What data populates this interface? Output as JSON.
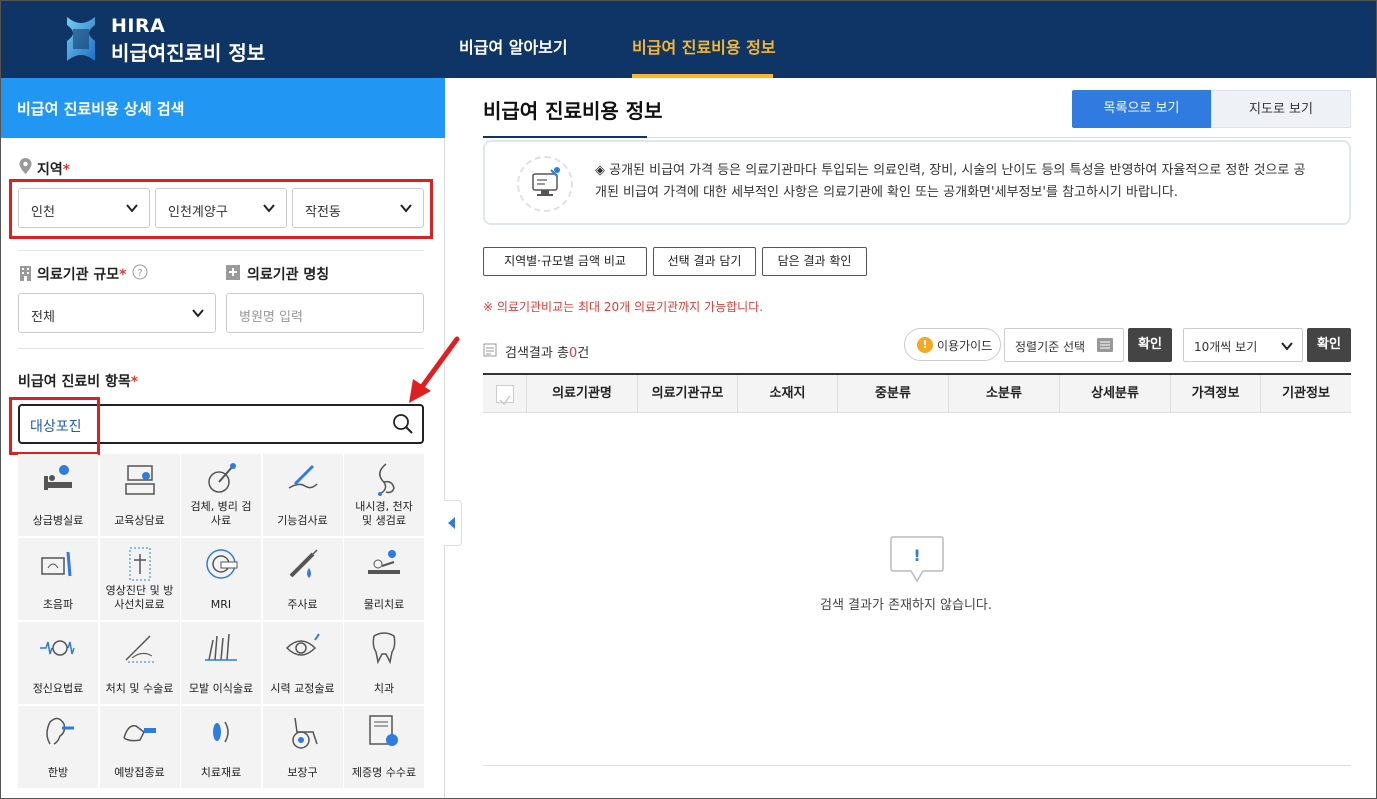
{
  "header": {
    "logo_line1": "HIRA",
    "logo_line2": "비급여진료비 정보",
    "nav": [
      {
        "label": "비급여 알아보기",
        "active": false
      },
      {
        "label": "비급여 진료비용 정보",
        "active": true
      }
    ]
  },
  "left": {
    "heading": "비급여 진료비용 상세 검색",
    "region_label": "지역",
    "region_selects": [
      "인천",
      "인천계양구",
      "작전동"
    ],
    "scale_label": "의료기관 규모",
    "scale_value": "전체",
    "name_label": "의료기관 명칭",
    "name_placeholder": "병원명 입력",
    "item_label": "비급여 진료비 항목",
    "search_value": "대상포진",
    "required_mark": "*",
    "categories": [
      {
        "label": "상급병실료",
        "icon": "hospital-bed-icon"
      },
      {
        "label": "교육상담료",
        "icon": "counseling-desk-icon"
      },
      {
        "label": "검체, 병리 검사료",
        "icon": "specimen-test-icon"
      },
      {
        "label": "기능검사료",
        "icon": "function-test-icon"
      },
      {
        "label": "내시경, 천자 및 생검료",
        "icon": "endoscope-icon"
      },
      {
        "label": "초음파",
        "icon": "ultrasound-icon"
      },
      {
        "label": "영상진단 및 방사선치료료",
        "icon": "radiology-icon"
      },
      {
        "label": "MRI",
        "icon": "mri-icon"
      },
      {
        "label": "주사료",
        "icon": "syringe-icon"
      },
      {
        "label": "물리치료",
        "icon": "physical-therapy-icon"
      },
      {
        "label": "정신요법료",
        "icon": "brain-wave-icon"
      },
      {
        "label": "처치 및 수술료",
        "icon": "surgery-icon"
      },
      {
        "label": "모발 이식술료",
        "icon": "hair-transplant-icon"
      },
      {
        "label": "시력 교정술료",
        "icon": "eye-icon"
      },
      {
        "label": "치과",
        "icon": "tooth-icon"
      },
      {
        "label": "한방",
        "icon": "acupuncture-ear-icon"
      },
      {
        "label": "예방접종료",
        "icon": "vaccination-icon"
      },
      {
        "label": "치료재료",
        "icon": "treatment-material-icon"
      },
      {
        "label": "보장구",
        "icon": "wheelchair-icon"
      },
      {
        "label": "제증명 수수료",
        "icon": "certificate-icon"
      }
    ]
  },
  "main": {
    "title": "비급여 진료비용 정보",
    "view_list": "목록으로 보기",
    "view_map": "지도로 보기",
    "notice": "◈ 공개된 비급여 가격 등은 의료기관마다 투입되는 의료인력, 장비, 시술의 난이도 등의 특성을 반영하여 자율적으로 정한 것으로 공개된 비급여 가격에 대한 세부적인 사항은 의료기관에 확인 또는 공개화면'세부정보'를 참고하시기 바랍니다.",
    "actions": [
      "지역별·규모별 금액 비교",
      "선택 결과 담기",
      "담은 결과 확인"
    ],
    "warning": "※ 의료기관비교는 최대 20개 의료기관까지 가능합니다.",
    "result_prefix": "검색결과 총",
    "result_count": "0",
    "result_suffix": "건",
    "guide": "이용가이드",
    "sort_placeholder": "정렬기준 선택",
    "confirm": "확인",
    "per_page": "10개씩 보기",
    "columns": [
      "의료기관명",
      "의료기관규모",
      "소재지",
      "중분류",
      "소분류",
      "상세분류",
      "가격정보",
      "기관정보"
    ],
    "empty_message": "검색 결과가 존재하지 않습니다.",
    "empty_icon_glyph": "!"
  },
  "colors": {
    "header_bg": "#0f3466",
    "accent_yellow": "#f7b731",
    "left_head_bg": "#2196f3",
    "primary_button": "#2f7be0",
    "highlight_red": "#e02020"
  }
}
